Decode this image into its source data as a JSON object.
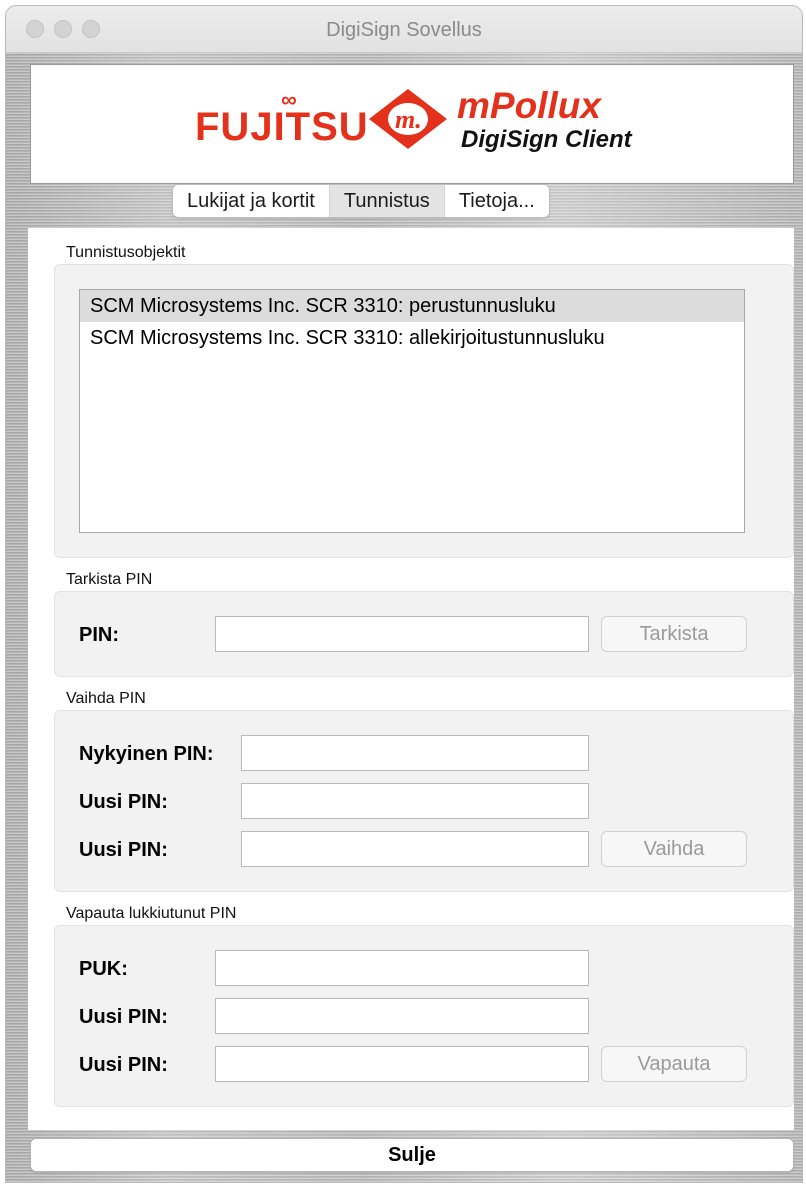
{
  "window": {
    "title": "DigiSign Sovellus"
  },
  "logo": {
    "brand": "FUJITSU",
    "product": "mPollux",
    "subtitle": "DigiSign Client",
    "colors": {
      "brand_red": "#e3311b"
    }
  },
  "tabs": [
    {
      "label": "Lukijat ja kortit",
      "selected": false
    },
    {
      "label": "Tunnistus",
      "selected": true
    },
    {
      "label": "Tietoja...",
      "selected": false
    }
  ],
  "objects": {
    "label": "Tunnistusobjektit",
    "items": [
      {
        "label": "SCM Microsystems Inc. SCR 3310: perustunnusluku",
        "selected": true
      },
      {
        "label": "SCM Microsystems Inc. SCR 3310: allekirjoitustunnusluku",
        "selected": false
      }
    ]
  },
  "verify_pin": {
    "label": "Tarkista PIN",
    "pin_label": "PIN:",
    "pin_value": "",
    "button": "Tarkista"
  },
  "change_pin": {
    "label": "Vaihda PIN",
    "current_label": "Nykyinen PIN:",
    "current_value": "",
    "new_label": "Uusi PIN:",
    "new_value": "",
    "confirm_label": "Uusi PIN:",
    "confirm_value": "",
    "button": "Vaihda"
  },
  "unblock_pin": {
    "label": "Vapauta lukkiutunut PIN",
    "puk_label": "PUK:",
    "puk_value": "",
    "new_label": "Uusi PIN:",
    "new_value": "",
    "confirm_label": "Uusi PIN:",
    "confirm_value": "",
    "button": "Vapauta"
  },
  "footer": {
    "close_button": "Sulje"
  }
}
